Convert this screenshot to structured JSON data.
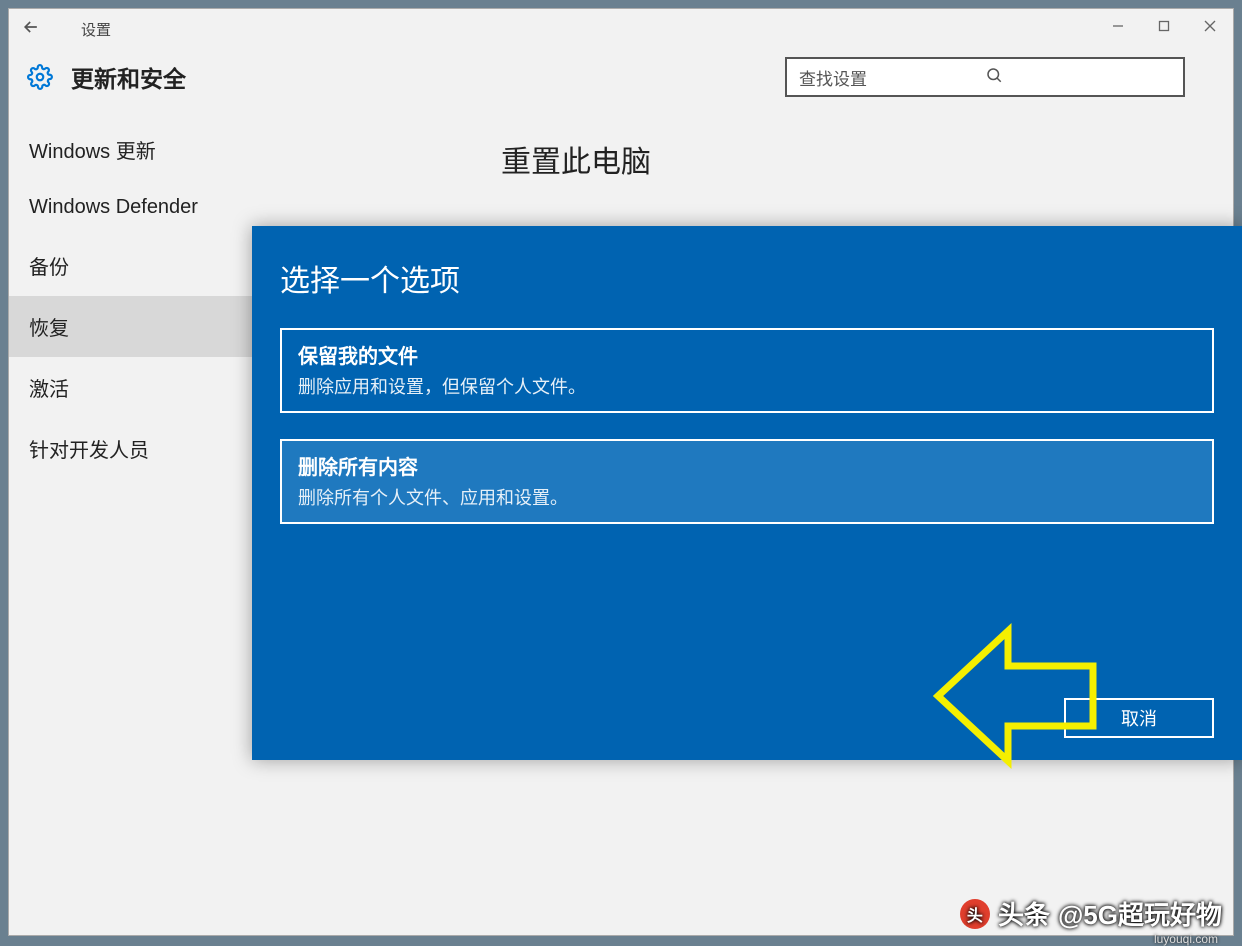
{
  "titlebar": {
    "app_name": "设置"
  },
  "header": {
    "section_title": "更新和安全",
    "search_placeholder": "查找设置"
  },
  "sidebar": {
    "items": [
      {
        "label": "Windows 更新",
        "selected": false
      },
      {
        "label": "Windows Defender",
        "selected": false
      },
      {
        "label": "备份",
        "selected": false
      },
      {
        "label": "恢复",
        "selected": true
      },
      {
        "label": "激活",
        "selected": false
      },
      {
        "label": "针对开发人员",
        "selected": false
      }
    ]
  },
  "main": {
    "heading": "重置此电脑"
  },
  "dialog": {
    "title": "选择一个选项",
    "options": [
      {
        "title": "保留我的文件",
        "desc": "删除应用和设置，但保留个人文件。",
        "selected": false
      },
      {
        "title": "删除所有内容",
        "desc": "删除所有个人文件、应用和设置。",
        "selected": true
      }
    ],
    "cancel_label": "取消"
  },
  "watermark": {
    "prefix": "头条",
    "handle": "@5G超玩好物",
    "url": "luyouqi.com"
  }
}
